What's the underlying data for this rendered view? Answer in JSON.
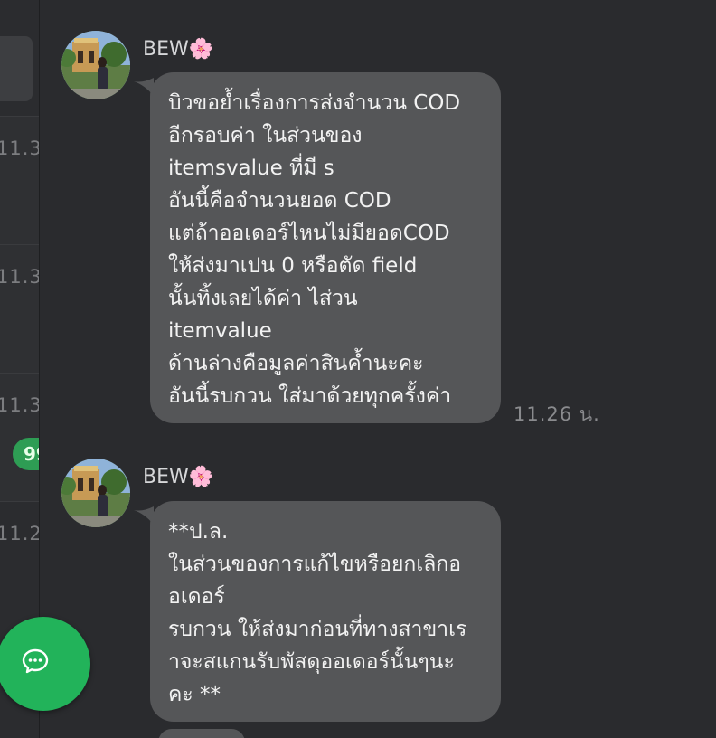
{
  "sidebar": {
    "times": [
      "11.3",
      "11.3",
      "11.3",
      "11.2"
    ],
    "badge": "99",
    "fab_icon": "chat-bubble-icon"
  },
  "messages": [
    {
      "sender": "BEW🌸",
      "lines": [
        "บิวขอย้ำเรื่องการส่งจำนวน COD",
        "อีกรอบค่า ในส่วนของ",
        "itemsvalue ที่มี s",
        "อันนี้คือจำนวนยอด COD",
        "แต่ถ้าออเดอร์ไหนไม่มียอดCOD",
        " ให้ส่งมาเปน 0 หรือตัด field",
        "นั้นทิ้งเลยได้ค่า ไส่วน",
        "itemvalue",
        "ด้านล่างคือมูลค่าสินค้ำนะคะ",
        "อันนี้รบกวน ใส่มาด้วยทุกครั้งค่า"
      ],
      "time": "11.26 น."
    },
    {
      "sender": "BEW🌸",
      "lines": [
        "**ป.ล.",
        " ในส่วนของการแก้ไขหรือยกเลิกอ",
        "อเดอร์",
        "รบกวน ให้ส่งมาก่อนที่ทางสาขาเร",
        "าจะสแกนรับพัสดุออเดอร์นั้นๆนะ",
        "คะ **"
      ],
      "time": ""
    }
  ],
  "colors": {
    "background": "#2a2b2e",
    "bubble": "#555658",
    "badge": "#2e9d54",
    "fab": "#22b35a"
  }
}
